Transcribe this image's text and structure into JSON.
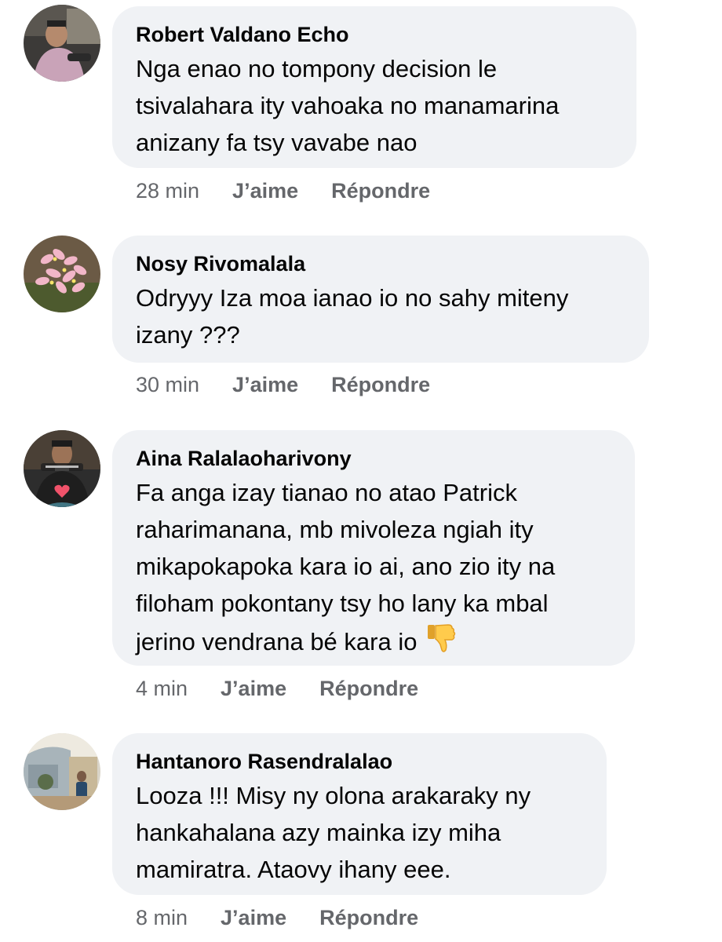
{
  "comments": [
    {
      "author": "Robert Valdano Echo",
      "lines": [
        "Nga enao no tompony decision le",
        "tsivalahara ity vahoaka no manamarina",
        "anizany fa tsy vavabe nao"
      ],
      "time": "28 min",
      "like_label": "J’aime",
      "reply_label": "Répondre"
    },
    {
      "author": "Nosy Rivomalala",
      "lines": [
        "Odryyy Iza moa ianao io no sahy miteny",
        "izany ???"
      ],
      "time": "30 min",
      "like_label": "J’aime",
      "reply_label": "Répondre"
    },
    {
      "author": "Aina Ralalaoharivony",
      "lines": [
        "Fa anga izay tianao no atao Patrick",
        "raharimanana, mb mivoleza ngiah ity",
        "mikapokapoka kara io ai, ano zio ity na",
        "filoham pokontany tsy ho lany ka mbal",
        "jerino vendrana bé kara io"
      ],
      "emoji": "thumbs-down-icon",
      "time": "4 min",
      "like_label": "J’aime",
      "reply_label": "Répondre"
    },
    {
      "author": "Hantanoro Rasendralalao",
      "lines": [
        "Looza !!! Misy ny olona arakaraky ny",
        "hankahalana  azy mainka izy miha",
        "mamiratra. Ataovy ihany eee."
      ],
      "time": "8 min",
      "like_label": "J’aime",
      "reply_label": "Répondre"
    }
  ],
  "colors": {
    "bubble": "#f0f2f5",
    "text": "#050505",
    "meta": "#65676b"
  }
}
